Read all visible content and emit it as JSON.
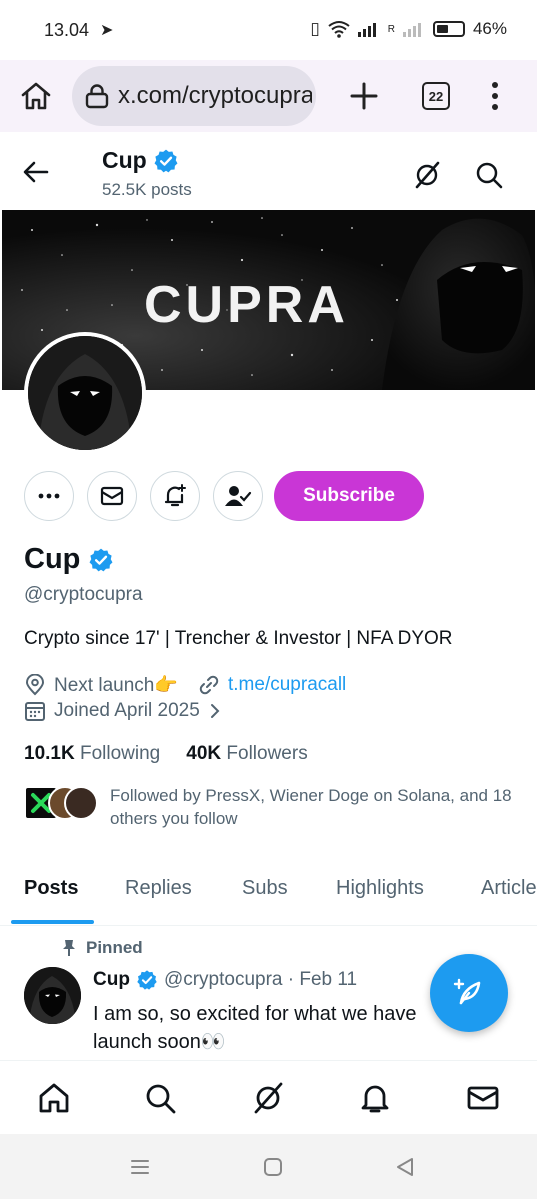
{
  "status_bar": {
    "time": "13.04",
    "battery": "46%",
    "battery_level": 0.46,
    "network": "R"
  },
  "browser": {
    "url": "x.com/cryptocupra",
    "tab_count": "22"
  },
  "header": {
    "name": "Cup",
    "posts_count": "52.5K posts"
  },
  "banner": {
    "text": "CUPRA"
  },
  "profile": {
    "display_name": "Cup",
    "handle": "@cryptocupra",
    "bio": "Crypto since 17' | Trencher & Investor | NFA DYOR",
    "location": "Next launch👉",
    "link": "t.me/cupracall",
    "joined": "Joined April 2025",
    "following_count": "10.1K",
    "following_label": "Following",
    "followers_count": "40K",
    "followers_label": "Followers",
    "followed_by": "Followed by PressX, Wiener Doge on Solana, and 18 others you follow",
    "subscribe_label": "Subscribe"
  },
  "tabs": [
    {
      "label": "Posts",
      "active": true
    },
    {
      "label": "Replies",
      "active": false
    },
    {
      "label": "Subs",
      "active": false
    },
    {
      "label": "Highlights",
      "active": false
    },
    {
      "label": "Articles",
      "active": false
    }
  ],
  "post": {
    "pinned_label": "Pinned",
    "author": "Cup",
    "handle_date": "@cryptocupra · Feb 11",
    "text_line1": "I am so, so excited for what we have",
    "text_line2": "launch soon👀"
  },
  "colors": {
    "accent": "#1d9bf0",
    "subscribe": "#c936d6",
    "muted": "#536471"
  }
}
